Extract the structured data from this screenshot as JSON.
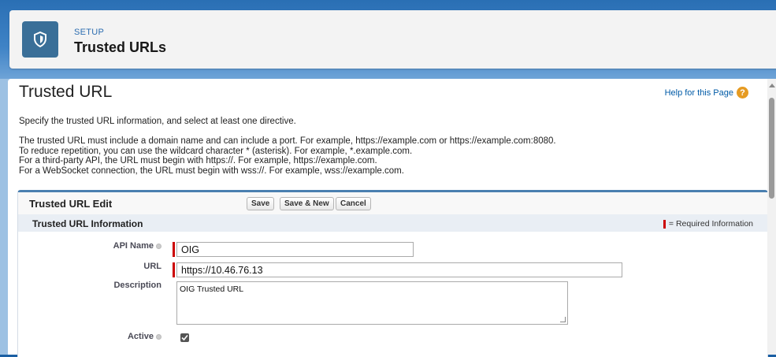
{
  "header": {
    "eyebrow": "SETUP",
    "title": "Trusted URLs",
    "icon": "shield-icon"
  },
  "page": {
    "title": "Trusted URL",
    "help_link": "Help for this Page",
    "intro": "Specify the trusted URL information, and select at least one directive.",
    "rules": [
      "The trusted URL must include a domain name and can include a port. For example, https://example.com or https://example.com:8080.",
      "To reduce repetition, you can use the wildcard character * (asterisk). For example, *.example.com.",
      "For a third-party API, the URL must begin with https://. For example, https://example.com.",
      "For a WebSocket connection, the URL must begin with wss://. For example, wss://example.com."
    ]
  },
  "edit": {
    "title": "Trusted URL Edit",
    "buttons": {
      "save": "Save",
      "save_new": "Save & New",
      "cancel": "Cancel"
    },
    "section_title": "Trusted URL Information",
    "required_note": "= Required Information"
  },
  "fields": {
    "api_name": {
      "label": "API Name",
      "value": "OIG"
    },
    "url": {
      "label": "URL",
      "value": "https://10.46.76.13"
    },
    "description": {
      "label": "Description",
      "value": "OIG Trusted URL"
    },
    "active": {
      "label": "Active",
      "checked": true
    }
  },
  "colors": {
    "header_icon_bg": "#3a6f98",
    "link": "#015ba7",
    "required": "#cc0000",
    "section_bar": "#e9eef4"
  }
}
